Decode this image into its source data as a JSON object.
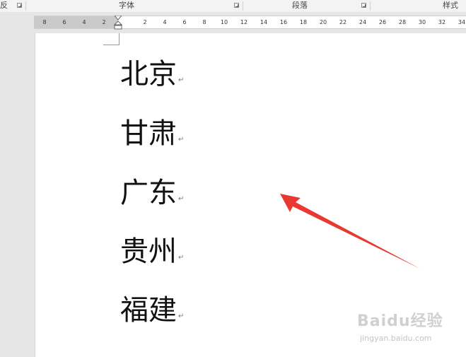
{
  "ribbon": {
    "groups": [
      {
        "label": "反"
      },
      {
        "label": "字体"
      },
      {
        "label": "段落"
      },
      {
        "label": "样式"
      }
    ]
  },
  "ruler": {
    "left_ticks": [
      "8",
      "6",
      "4",
      "2"
    ],
    "right_ticks": [
      "2",
      "4",
      "6",
      "8",
      "10",
      "12",
      "14",
      "16",
      "18",
      "20",
      "22",
      "24",
      "26",
      "28",
      "30",
      "32",
      "34"
    ]
  },
  "document": {
    "lines": [
      "北京",
      "甘肃",
      "广东",
      "贵州",
      "福建"
    ],
    "paragraph_mark": "↵"
  },
  "annotation": {
    "arrow_color": "#e8382f"
  },
  "watermark": {
    "logo": "Baidu经验",
    "url": "jingyan.baidu.com"
  }
}
